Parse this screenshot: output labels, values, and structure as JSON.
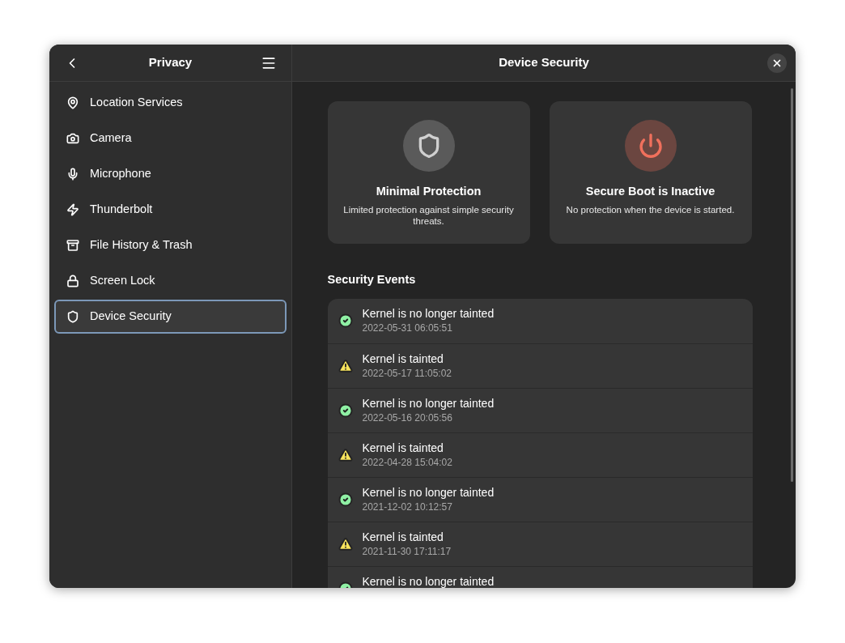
{
  "sidebar": {
    "title": "Privacy",
    "items": [
      {
        "label": "Location Services",
        "kind": "pin",
        "selected": false
      },
      {
        "label": "Camera",
        "kind": "camera",
        "selected": false
      },
      {
        "label": "Microphone",
        "kind": "mic",
        "selected": false
      },
      {
        "label": "Thunderbolt",
        "kind": "bolt",
        "selected": false
      },
      {
        "label": "File History & Trash",
        "kind": "cabinet",
        "selected": false
      },
      {
        "label": "Screen Lock",
        "kind": "lock",
        "selected": false
      },
      {
        "label": "Device Security",
        "kind": "shield",
        "selected": true
      }
    ]
  },
  "main": {
    "title": "Device Security",
    "cards": [
      {
        "kind": "shield",
        "title": "Minimal Protection",
        "description": "Limited protection against simple security threats."
      },
      {
        "kind": "power",
        "title": "Secure Boot is Inactive",
        "description": "No protection when the device is started."
      }
    ],
    "events_title": "Security Events",
    "events": [
      {
        "kind": "ok",
        "title": "Kernel is no longer tainted",
        "date": "2022-05-31 06:05:51"
      },
      {
        "kind": "warning",
        "title": "Kernel is tainted",
        "date": "2022-05-17 11:05:02"
      },
      {
        "kind": "ok",
        "title": "Kernel is no longer tainted",
        "date": "2022-05-16 20:05:56"
      },
      {
        "kind": "warning",
        "title": "Kernel is tainted",
        "date": "2022-04-28 15:04:02"
      },
      {
        "kind": "ok",
        "title": "Kernel is no longer tainted",
        "date": "2021-12-02 10:12:57"
      },
      {
        "kind": "warning",
        "title": "Kernel is tainted",
        "date": "2021-11-30 17:11:17"
      },
      {
        "kind": "ok",
        "title": "Kernel is no longer tainted"
      }
    ]
  }
}
